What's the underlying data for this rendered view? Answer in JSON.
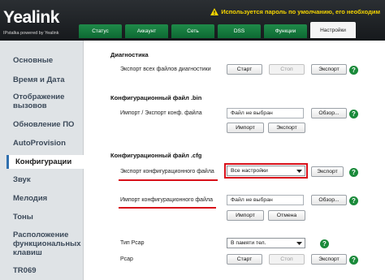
{
  "header": {
    "logo": "Yealink",
    "powered_by": "IPstalka powered by Yealink",
    "warning": "Используется пароль по умолчанию, его необходим",
    "tabs": [
      "Статус",
      "Аккаунт",
      "Сеть",
      "DSS",
      "Функции",
      "Настройки"
    ],
    "active_tab": "Настройки"
  },
  "sidebar": {
    "items": [
      "Основные",
      "Время и Дата",
      "Отображение",
      "вызовов",
      "Обновление ПО",
      "AutoProvision",
      "Конфигурации",
      "Звук",
      "Мелодия",
      "Тоны",
      "Расположение",
      "функциональных",
      "клавиш",
      "TR069"
    ],
    "active_item": "Конфигурации"
  },
  "diagnostics": {
    "title": "Диагностика",
    "export_label": "Экспорт всех файлов диагностики",
    "start_button": "Старт",
    "stop_button": "Стоп",
    "export_button": "Экспорт"
  },
  "bin": {
    "title": "Конфигурационный файл .bin",
    "import_export_label": "Импорт / Экспорт конф. файла",
    "file_placeholder": "Файл не выбран",
    "browse_button": "Обзор...",
    "import_button": "Импорт",
    "export_button": "Экспорт"
  },
  "cfg": {
    "title": "Конфигурационный файл .cfg",
    "export_label": "Экспорт конфигурационного файла",
    "export_select": "Все настройки",
    "export_button": "Экспорт",
    "import_label": "Импорт конфигурационного файла",
    "file_placeholder": "Файл не выбран",
    "browse_button": "Обзор...",
    "import_button": "Импорт",
    "cancel_button": "Отмена"
  },
  "pcap": {
    "type_label": "Тип Pcap",
    "type_select": "В памяти тел.",
    "pcap_label": "Pcap",
    "start_button": "Старт",
    "stop_button": "Стоп",
    "export_button": "Экспорт"
  },
  "help_symbol": "?",
  "colors": {
    "header_bg": "#1e2226",
    "tab_green": "#168444",
    "help_green": "#1a8a3a",
    "highlight_red": "#d8101a",
    "warning_yellow": "#f4d400"
  }
}
